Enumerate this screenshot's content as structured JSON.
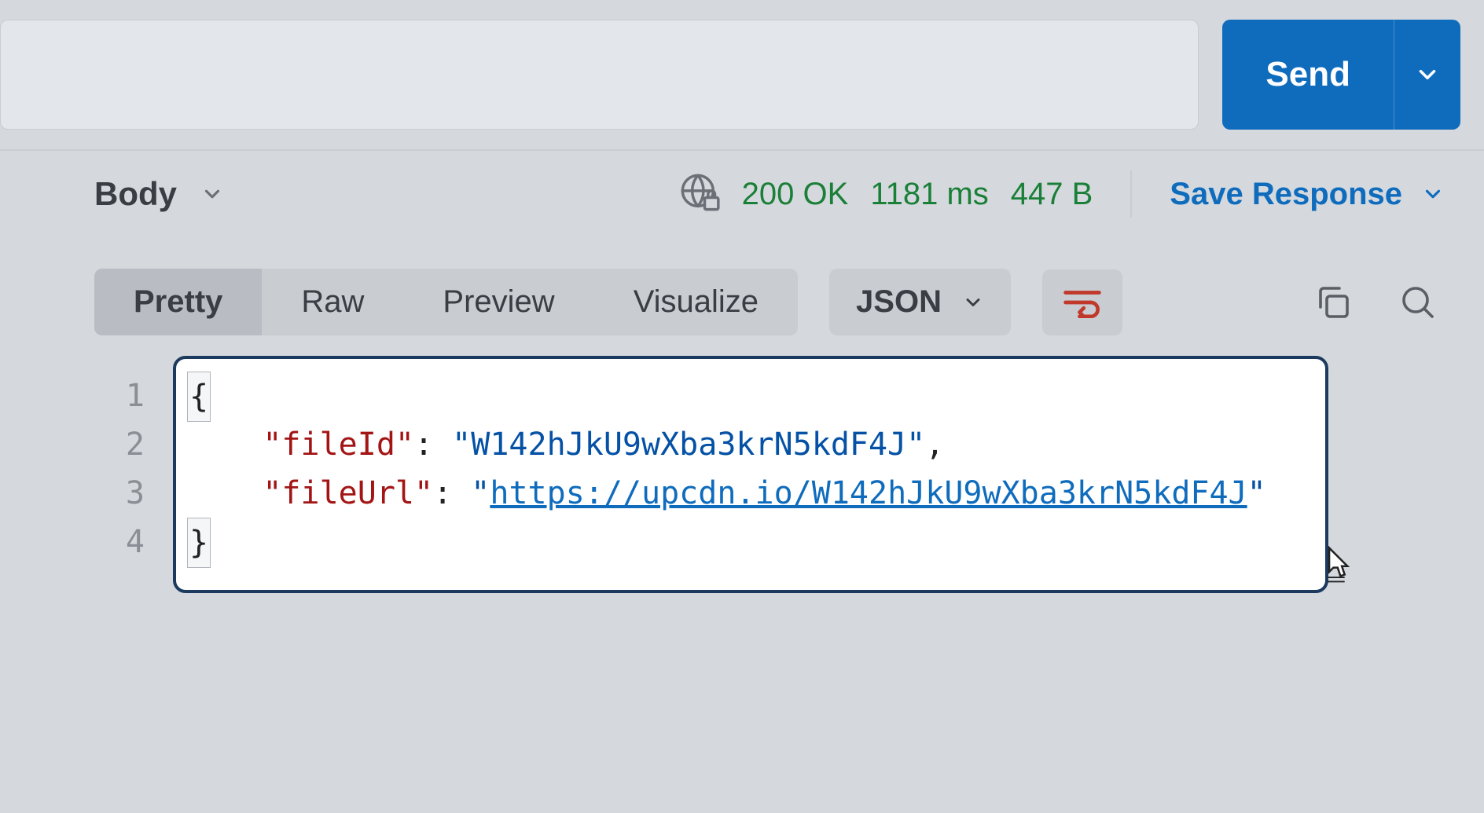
{
  "top": {
    "send_label": "Send"
  },
  "response_header": {
    "body_label": "Body",
    "status_code": "200 OK",
    "latency": "1181 ms",
    "size": "447 B",
    "save_response_label": "Save Response"
  },
  "toolbar": {
    "tabs": {
      "pretty": "Pretty",
      "raw": "Raw",
      "preview": "Preview",
      "visualize": "Visualize"
    },
    "format_label": "JSON"
  },
  "code": {
    "line_numbers": [
      "1",
      "2",
      "3",
      "4"
    ],
    "open_brace": "{",
    "close_brace": "}",
    "key1": "\"fileId\"",
    "val1": "\"W142hJkU9wXba3krN5kdF4J\"",
    "key2": "\"fileUrl\"",
    "val2_quote": "\"",
    "val2_link": "https://upcdn.io/W142hJkU9wXba3krN5kdF4J",
    "colon": ":",
    "comma": ","
  }
}
